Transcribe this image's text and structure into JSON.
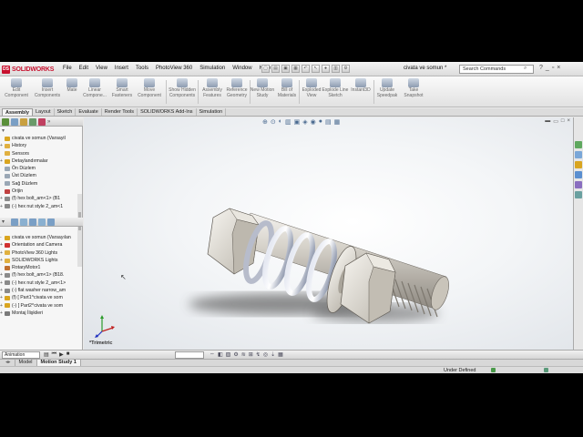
{
  "app": {
    "name": "SOLIDWORKS",
    "logo_badge": "DS"
  },
  "menubar": {
    "items": [
      "File",
      "Edit",
      "View",
      "Insert",
      "Tools",
      "PhotoView 360",
      "Simulation",
      "Window",
      "Help"
    ],
    "document_title": "civata ve somun *",
    "search_placeholder": "Search Commands"
  },
  "ribbon": {
    "buttons": [
      {
        "label": "Edit Component",
        "icon": "edit-component-icon"
      },
      {
        "label": "Insert Components",
        "icon": "insert-components-icon"
      },
      {
        "label": "Mate",
        "icon": "mate-icon"
      },
      {
        "label": "Linear Compone...",
        "icon": "linear-pattern-icon"
      },
      {
        "label": "Smart Fasteners",
        "icon": "smart-fasteners-icon"
      },
      {
        "label": "Move Component",
        "icon": "move-component-icon"
      },
      {
        "label": "Show Hidden Components",
        "icon": "show-hidden-icon"
      },
      {
        "label": "Assembly Features",
        "icon": "assembly-features-icon"
      },
      {
        "label": "Reference Geometry",
        "icon": "reference-geometry-icon"
      },
      {
        "label": "New Motion Study",
        "icon": "motion-study-icon"
      },
      {
        "label": "Bill of Materials",
        "icon": "bom-icon"
      },
      {
        "label": "Exploded View",
        "icon": "exploded-view-icon"
      },
      {
        "label": "Explode Line Sketch",
        "icon": "explode-line-icon"
      },
      {
        "label": "Instant3D",
        "icon": "instant3d-icon"
      },
      {
        "label": "Update Speedpak",
        "icon": "speedpak-icon"
      },
      {
        "label": "Take Snapshot",
        "icon": "snapshot-icon"
      }
    ]
  },
  "tabs": [
    "Assembly",
    "Layout",
    "Sketch",
    "Evaluate",
    "Render Tools",
    "SOLIDWORKS Add-Ins",
    "Simulation"
  ],
  "feature_tree": {
    "items": [
      {
        "label": "civata ve somun  (Varsayil",
        "color": "#d9a520",
        "exp": ""
      },
      {
        "label": "History",
        "color": "#e0b040",
        "exp": "+"
      },
      {
        "label": "Sensors",
        "color": "#e0b040",
        "exp": ""
      },
      {
        "label": "Detaylandırmalar",
        "color": "#d9a520",
        "exp": "+"
      },
      {
        "label": "Ön Düzlem",
        "color": "#9aa7b5",
        "exp": ""
      },
      {
        "label": "Üst Düzlem",
        "color": "#9aa7b5",
        "exp": ""
      },
      {
        "label": "Sağ Düzlem",
        "color": "#9aa7b5",
        "exp": ""
      },
      {
        "label": "Orijin",
        "color": "#c04040",
        "exp": ""
      },
      {
        "label": "(f) hex bolt_am<1> (B1",
        "color": "#8a8a8a",
        "exp": "+"
      },
      {
        "label": "(-) hex nut style 2_am<1",
        "color": "#8a8a8a",
        "exp": "+"
      }
    ]
  },
  "motion_tree": {
    "items": [
      {
        "label": "civata ve somun  (Varsayılan",
        "color": "#d9a520",
        "exp": "-"
      },
      {
        "label": "Orientation and Camera",
        "color": "#d03030",
        "exp": "+"
      },
      {
        "label": "PhotoView 360 Lights",
        "color": "#e0b040",
        "exp": "+"
      },
      {
        "label": "SOLIDWORKS Lights",
        "color": "#e0b040",
        "exp": "+"
      },
      {
        "label": "RotaryMotor1",
        "color": "#c07030",
        "exp": ""
      },
      {
        "label": "(f) hex bolt_am<1> (B18.",
        "color": "#8a8a8a",
        "exp": "+"
      },
      {
        "label": "(-) hex nut style 2_am<1>",
        "color": "#8a8a8a",
        "exp": "+"
      },
      {
        "label": "(-) flat washer narrow_am",
        "color": "#8a8a8a",
        "exp": "+"
      },
      {
        "label": "(f) [ Part1^civata ve som",
        "color": "#d9a520",
        "exp": "+"
      },
      {
        "label": "(-) [ Part2^civata ve som",
        "color": "#d9a520",
        "exp": "+"
      },
      {
        "label": "Montaj İlişkileri",
        "color": "#7a7a7a",
        "exp": "+"
      }
    ]
  },
  "viewport": {
    "view_name": "*Trimetric"
  },
  "motion_bar": {
    "study_type": "Animation"
  },
  "bottom_tabs": [
    "Model",
    "Motion Study 1"
  ],
  "status_bar": {
    "state": "Under Defined"
  }
}
